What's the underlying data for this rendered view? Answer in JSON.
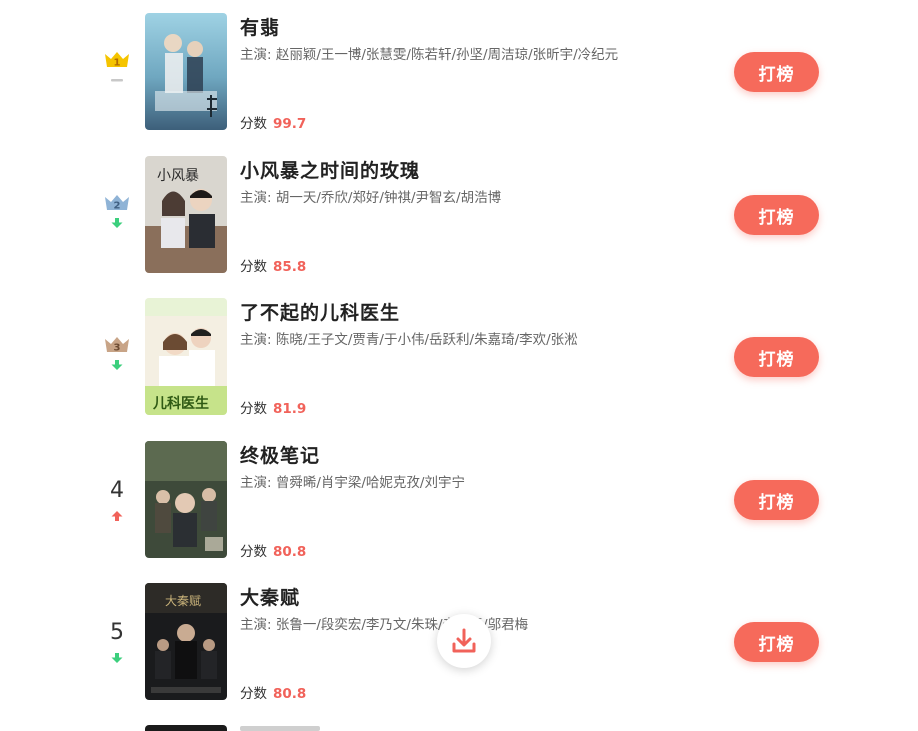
{
  "list": {
    "items": [
      {
        "rank": "1",
        "crown_label": "1",
        "crown_color": "#f5c400",
        "trend": "flat",
        "title": "有翡",
        "cast": "主演: 赵丽颖/王一博/张慧雯/陈若轩/孙坚/周洁琼/张昕宇/冷纪元",
        "score_label": "分数",
        "score": "99.7",
        "button": "打榜"
      },
      {
        "rank": "2",
        "crown_label": "2",
        "crown_color": "#8fb3d6",
        "trend": "down",
        "title": "小风暴之时间的玫瑰",
        "cast": "主演: 胡一天/乔欣/郑好/钟祺/尹智玄/胡浩博",
        "score_label": "分数",
        "score": "85.8",
        "button": "打榜"
      },
      {
        "rank": "3",
        "crown_label": "3",
        "crown_color": "#c8a487",
        "trend": "down",
        "title": "了不起的儿科医生",
        "cast": "主演: 陈晓/王子文/贾青/于小伟/岳跃利/朱嘉琦/李欢/张淞",
        "score_label": "分数",
        "score": "81.9",
        "button": "打榜"
      },
      {
        "rank": "4",
        "crown_label": "",
        "crown_color": "",
        "trend": "up",
        "title": "终极笔记",
        "cast": "主演: 曾舜晞/肖宇梁/哈妮克孜/刘宇宁",
        "score_label": "分数",
        "score": "80.8",
        "button": "打榜"
      },
      {
        "rank": "5",
        "crown_label": "",
        "crown_color": "",
        "trend": "down",
        "title": "大秦赋",
        "cast": "主演: 张鲁一/段奕宏/李乃文/朱珠/辛柏青/邬君梅",
        "score_label": "分数",
        "score": "80.8",
        "button": "打榜"
      }
    ]
  },
  "colors": {
    "accent": "#f66a5b",
    "score": "#f1625a",
    "trend_up": "#f1625a",
    "trend_down": "#3ccf7d",
    "trend_flat": "#c8c8c8"
  },
  "icons": {
    "fab": "download-icon"
  }
}
